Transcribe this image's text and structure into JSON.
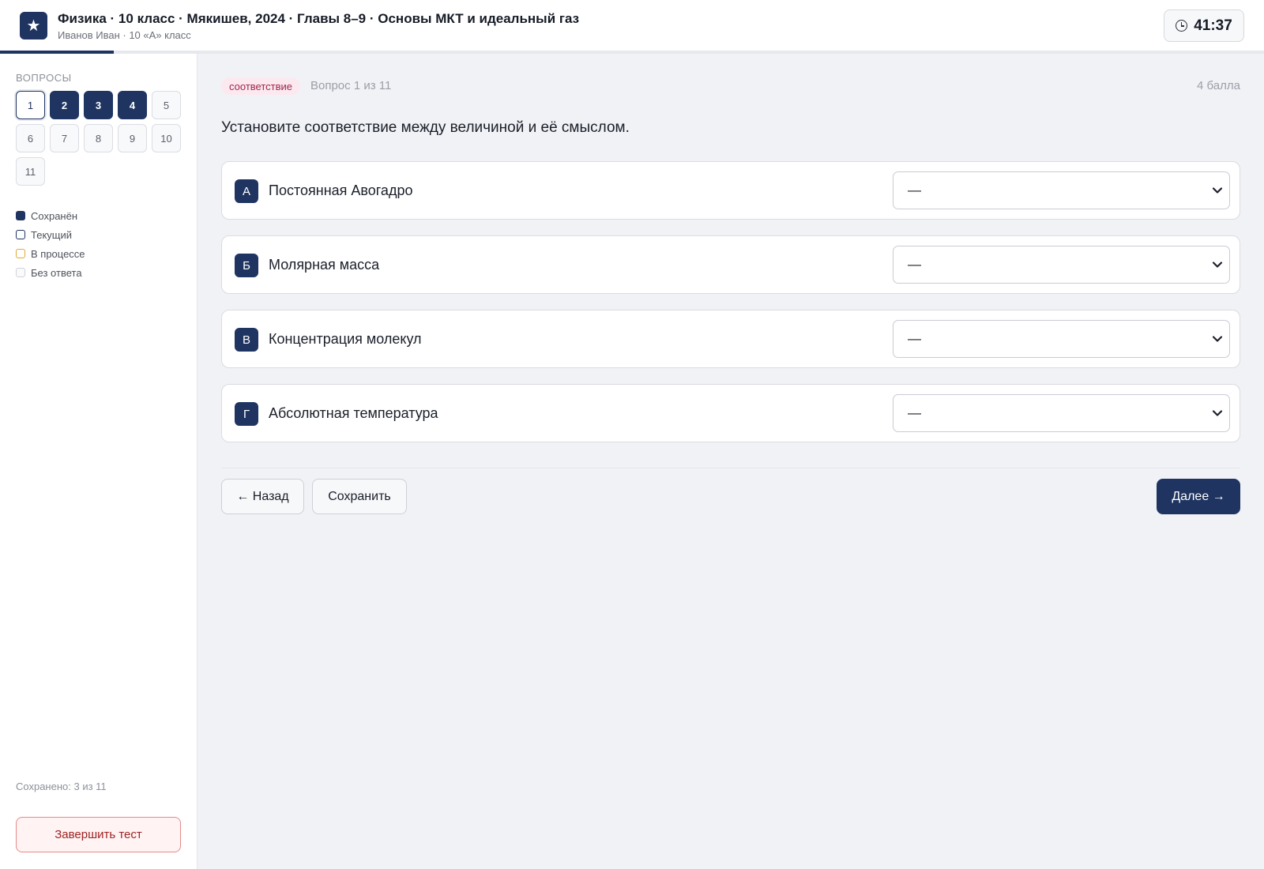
{
  "header": {
    "logo_glyph": "★",
    "title": "Физика · 10 класс · Мякишев, 2024 · Главы 8–9 · Основы МКТ и идеальный газ",
    "subtitle": "Иванов Иван · 10 «А» класс",
    "timer": "41:37",
    "progress_fraction": 0.09
  },
  "sidebar": {
    "heading": "ВОПРОСЫ",
    "questions": [
      {
        "label": "1",
        "state": "current"
      },
      {
        "label": "2",
        "state": "saved"
      },
      {
        "label": "3",
        "state": "saved"
      },
      {
        "label": "4",
        "state": "saved"
      },
      {
        "label": "5",
        "state": "unanswered"
      },
      {
        "label": "6",
        "state": "unanswered"
      },
      {
        "label": "7",
        "state": "unanswered"
      },
      {
        "label": "8",
        "state": "unanswered"
      },
      {
        "label": "9",
        "state": "unanswered"
      },
      {
        "label": "10",
        "state": "unanswered"
      },
      {
        "label": "11",
        "state": "unanswered"
      }
    ],
    "legend": [
      {
        "label": "Сохранён",
        "kind": "saved"
      },
      {
        "label": "Текущий",
        "kind": "current"
      },
      {
        "label": "В процессе",
        "kind": "progress"
      },
      {
        "label": "Без ответа",
        "kind": "none"
      }
    ],
    "saved_count": "Сохранено: 3 из 11",
    "finish_label": "Завершить тест"
  },
  "main": {
    "type_badge": "соответствие",
    "question_number": "Вопрос 1 из 11",
    "points": "4 балла",
    "question_text": "Установите соответствие между величиной и её смыслом.",
    "rows": [
      {
        "letter": "А",
        "label": "Постоянная Авогадро",
        "selected": "—"
      },
      {
        "letter": "Б",
        "label": "Молярная масса",
        "selected": "—"
      },
      {
        "letter": "В",
        "label": "Концентрация молекул",
        "selected": "—"
      },
      {
        "letter": "Г",
        "label": "Абсолютная температура",
        "selected": "—"
      }
    ],
    "back_label": "← Назад",
    "save_label": "Сохранить",
    "next_label": "Далее →"
  },
  "colors": {
    "accent": "#1f3461",
    "badge_bg": "#fbe9ef",
    "badge_text": "#a1264e",
    "finish_border": "#e78a8a",
    "in_progress": "#e0a93a"
  },
  "icons": {
    "logo": "star-icon",
    "timer": "clock-icon",
    "select": "chevron-down-icon"
  }
}
